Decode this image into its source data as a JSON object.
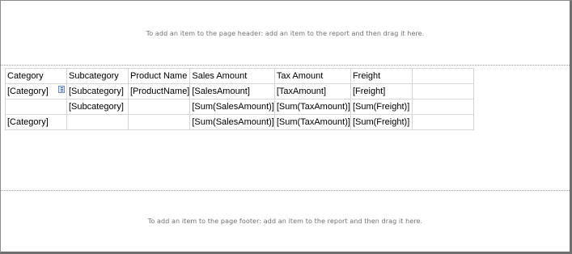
{
  "report": {
    "header_hint": "To add an item to the page header: add an item to the report and then drag it here.",
    "footer_hint": "To add an item to the page footer: add an item to the report and then drag it here."
  },
  "tablix": {
    "header": [
      "Category",
      "Subcategory",
      "Product Name",
      "Sales Amount",
      "Tax Amount",
      "Freight",
      ""
    ],
    "rows": [
      [
        "[Category]",
        "[Subcategory]",
        "[ProductName]",
        "[SalesAmount]",
        "[TaxAmount]",
        "[Freight]",
        ""
      ],
      [
        "",
        "[Subcategory]",
        "",
        "[Sum(SalesAmount)]",
        "[Sum(TaxAmount)]",
        "[Sum(Freight)]",
        ""
      ],
      [
        "[Category]",
        "",
        "",
        "[Sum(SalesAmount)]",
        "[Sum(TaxAmount)]",
        "[Sum(Freight)]",
        ""
      ]
    ],
    "group_icon": "group-indicator-icon"
  }
}
